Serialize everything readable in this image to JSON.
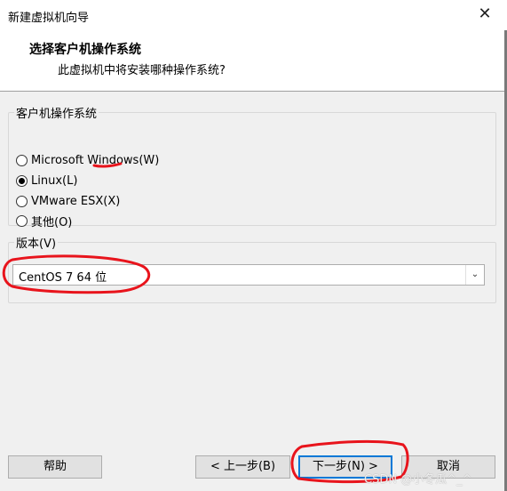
{
  "window": {
    "title": "新建虚拟机向导"
  },
  "header": {
    "title": "选择客户机操作系统",
    "subtitle": "此虚拟机中将安装哪种操作系统?"
  },
  "os_group": {
    "legend": "客户机操作系统",
    "options": [
      {
        "label": "Microsoft Windows(W)",
        "checked": false
      },
      {
        "label": "Linux(L)",
        "checked": true
      },
      {
        "label": "VMware ESX(X)",
        "checked": false
      },
      {
        "label": "其他(O)",
        "checked": false
      }
    ]
  },
  "version_group": {
    "legend": "版本(V)",
    "selected": "CentOS 7 64 位"
  },
  "buttons": {
    "help": "帮助",
    "back": "< 上一步(B)",
    "next": "下一步(N) >",
    "cancel": "取消"
  },
  "watermark": "CSDN @小冬瓜^_^",
  "colors": {
    "annotation_red": "#e8141c",
    "focus_blue": "#0078d7",
    "background": "#f0f0f0"
  }
}
